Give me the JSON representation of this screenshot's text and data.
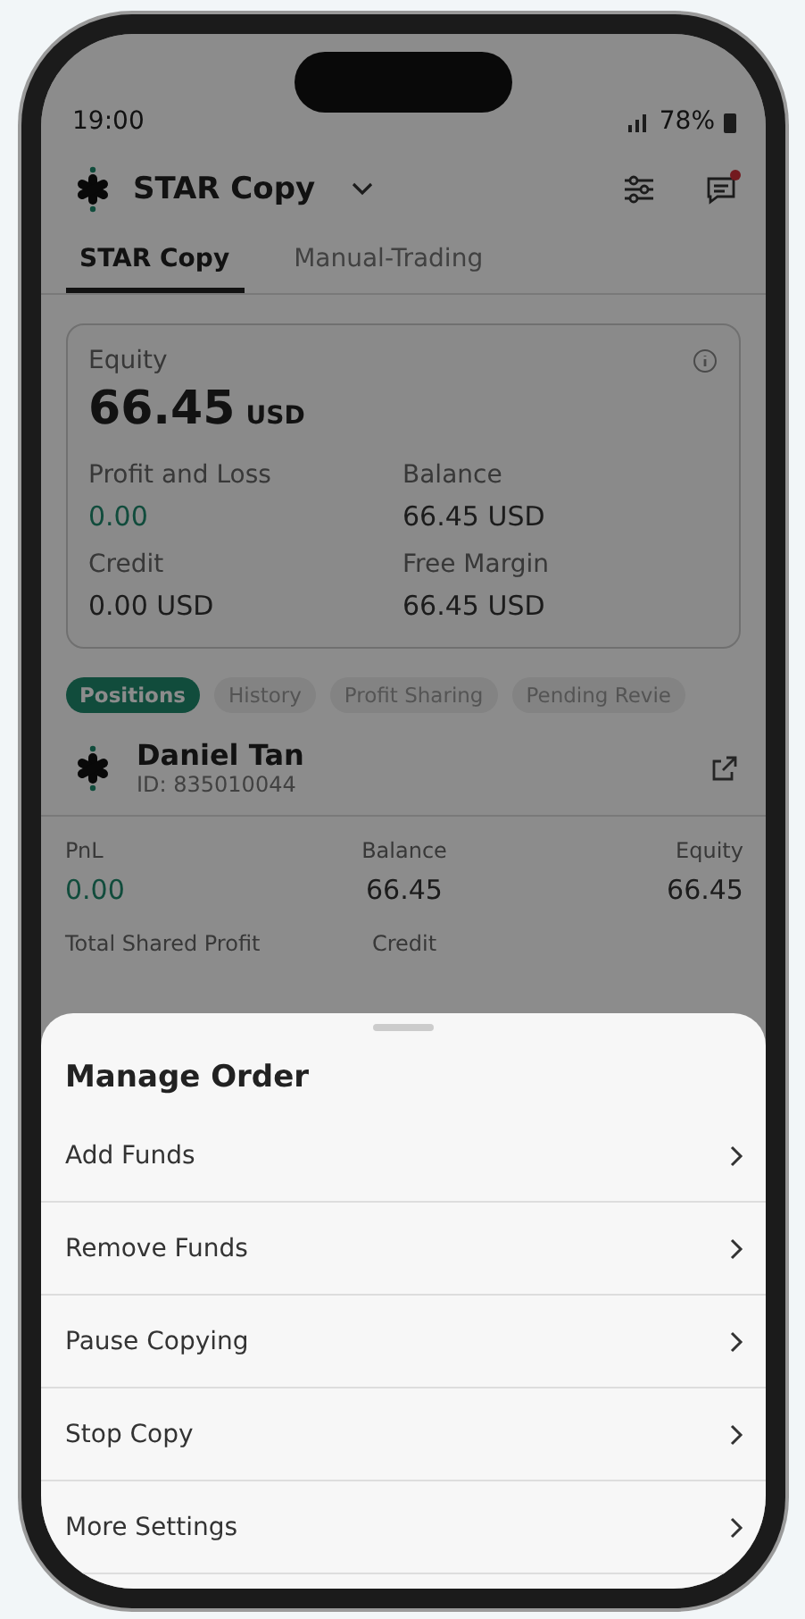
{
  "status_bar": {
    "time": "19:00",
    "battery": "78%"
  },
  "header": {
    "title": "STAR Copy",
    "has_notification": true
  },
  "tabs": [
    {
      "label": "STAR Copy",
      "selected": true
    },
    {
      "label": "Manual-Trading",
      "selected": false
    }
  ],
  "account": {
    "label": "Equity",
    "value": "66.45",
    "unit": "USD",
    "fields": [
      {
        "label": "Profit and Loss",
        "value": "0.00",
        "kind": "positive"
      },
      {
        "label": "Balance",
        "value": "66.45 USD",
        "kind": "plain"
      },
      {
        "label": "Credit",
        "value": "0.00 USD",
        "kind": "plain"
      },
      {
        "label": "Free Margin",
        "value": "66.45 USD",
        "kind": "plain"
      }
    ]
  },
  "filters": [
    {
      "label": "Positions",
      "selected": true
    },
    {
      "label": "History",
      "selected": false
    },
    {
      "label": "Profit Sharing",
      "selected": false
    },
    {
      "label": "Pending Revie",
      "selected": false
    }
  ],
  "trader": {
    "name": "Daniel Tan",
    "id": "ID: 835010044"
  },
  "stats": [
    {
      "label": "PnL",
      "value": "0.00",
      "kind": "positive"
    },
    {
      "label": "Balance",
      "value": "66.45",
      "kind": "plain"
    },
    {
      "label": "Equity",
      "value": "66.45",
      "kind": "plain"
    },
    {
      "label": "Total Shared Profit"
    },
    {
      "label": "Credit"
    }
  ],
  "sheet": {
    "title": "Manage Order",
    "items": [
      {
        "label": "Add Funds"
      },
      {
        "label": "Remove Funds"
      },
      {
        "label": "Pause Copying"
      },
      {
        "label": "Stop Copy"
      },
      {
        "label": "More Settings"
      }
    ]
  }
}
